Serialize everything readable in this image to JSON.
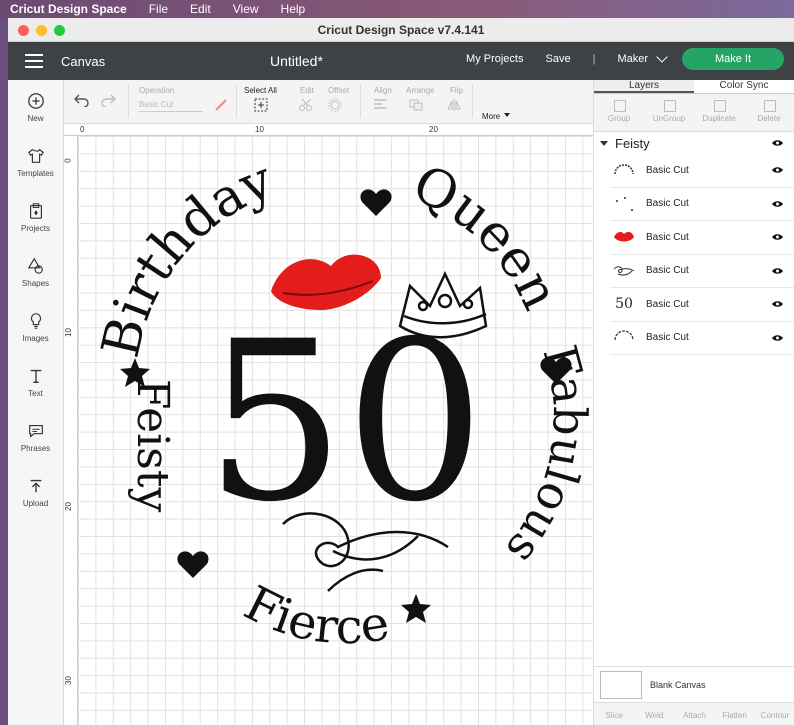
{
  "menubar": {
    "app": "Cricut Design Space",
    "items": [
      "File",
      "Edit",
      "View",
      "Help"
    ]
  },
  "window": {
    "title": "Cricut Design Space  v7.4.141"
  },
  "header": {
    "section": "Canvas",
    "document": "Untitled*",
    "my_projects": "My Projects",
    "save": "Save",
    "divider": "|",
    "machine": "Maker",
    "make_it": "Make It"
  },
  "rail": [
    {
      "label": "New",
      "icon": "plus-circle-icon"
    },
    {
      "label": "Templates",
      "icon": "shirt-icon"
    },
    {
      "label": "Projects",
      "icon": "clipboard-icon"
    },
    {
      "label": "Shapes",
      "icon": "shapes-icon"
    },
    {
      "label": "Images",
      "icon": "bulb-icon"
    },
    {
      "label": "Text",
      "icon": "text-icon"
    },
    {
      "label": "Phrases",
      "icon": "speech-icon"
    },
    {
      "label": "Upload",
      "icon": "upload-icon"
    }
  ],
  "toolbar": {
    "operation": "Operation",
    "operation_value": "Basic Cut",
    "select_all": "Select All",
    "edit": "Edit",
    "offset": "Offset",
    "align": "Align",
    "arrange": "Arrange",
    "flip": "Flip",
    "more": "More"
  },
  "ruler": {
    "top": [
      "0",
      "10",
      "20"
    ],
    "left": [
      "0",
      "10",
      "20",
      "30"
    ]
  },
  "design": {
    "arc_top_left": "Birthday",
    "arc_top_right": "Queen",
    "arc_right": "Fabulous",
    "arc_bottom": "Fierce",
    "arc_left": "Feisty",
    "number": "50",
    "accent_red": "#e31c1c"
  },
  "panel": {
    "tabs": [
      "Layers",
      "Color Sync"
    ],
    "actions": [
      "Group",
      "UnGroup",
      "Duplicate",
      "Delete"
    ],
    "group_name": "Feisty",
    "layers": [
      {
        "name": "Basic Cut",
        "thumb": "ring-text"
      },
      {
        "name": "Basic Cut",
        "thumb": "stars"
      },
      {
        "name": "Basic Cut",
        "thumb": "lips",
        "thumb_text": ""
      },
      {
        "name": "Basic Cut",
        "thumb": "swirl"
      },
      {
        "name": "Basic Cut",
        "thumb": "fifty",
        "thumb_text": "50"
      },
      {
        "name": "Basic Cut",
        "thumb": "arc-text"
      }
    ],
    "blank_canvas": "Blank Canvas",
    "bottom": [
      "Slice",
      "Weld",
      "Attach",
      "Flatten",
      "Contour"
    ]
  }
}
